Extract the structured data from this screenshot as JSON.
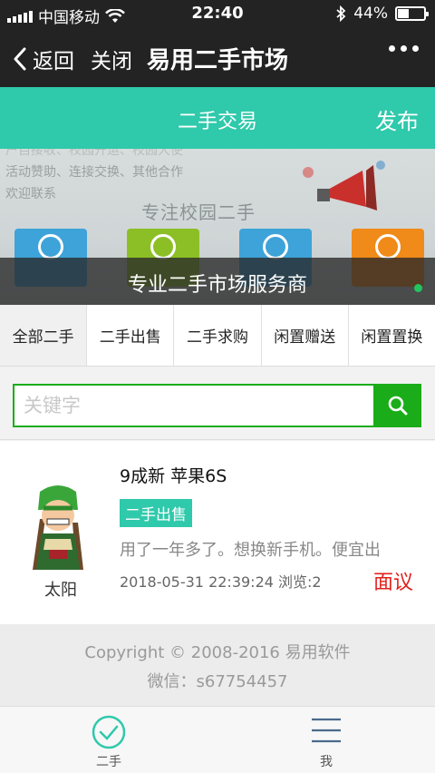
{
  "status": {
    "carrier": "中国移动",
    "time": "22:40",
    "battery": "44%",
    "battery_level": 0.44
  },
  "nav": {
    "back_label": "返回",
    "close_label": "关闭",
    "title": "易用二手市场"
  },
  "header": {
    "title": "二手交易",
    "publish_label": "发布"
  },
  "banner": {
    "faded_line1": "户自接收、校园开运、校园大使",
    "faded_line2": "活动赞助、连接交换、其他合作",
    "faded_line3": "欢迎联系",
    "subtitle": "专注校园二手",
    "caption": "专业二手市场服务商",
    "tile_colors": [
      "#3ea3d8",
      "#8cbf26",
      "#3ea3d8",
      "#f08a18"
    ]
  },
  "tabs": [
    {
      "label": "全部二手"
    },
    {
      "label": "二手出售"
    },
    {
      "label": "二手求购"
    },
    {
      "label": "闲置赠送"
    },
    {
      "label": "闲置置换"
    }
  ],
  "search": {
    "placeholder": "关键字"
  },
  "listing": {
    "title": "9成新 苹果6S",
    "badge": "二手出售",
    "description": "用了一年多了。想换新手机。便宜出",
    "meta": "2018-05-31 22:39:24 浏览:2",
    "price": "面议",
    "seller": "太阳"
  },
  "footer": {
    "copyright": "Copyright © 2008-2016 易用软件",
    "wechat": "微信：s67754457"
  },
  "tabbar": [
    {
      "label": "二手",
      "icon": "check-circle-icon"
    },
    {
      "label": "我",
      "icon": "menu-icon"
    }
  ],
  "colors": {
    "accent": "#2fc9ab",
    "search_green": "#1aad19",
    "price_red": "#e0211b",
    "dark_bar": "#232323"
  }
}
